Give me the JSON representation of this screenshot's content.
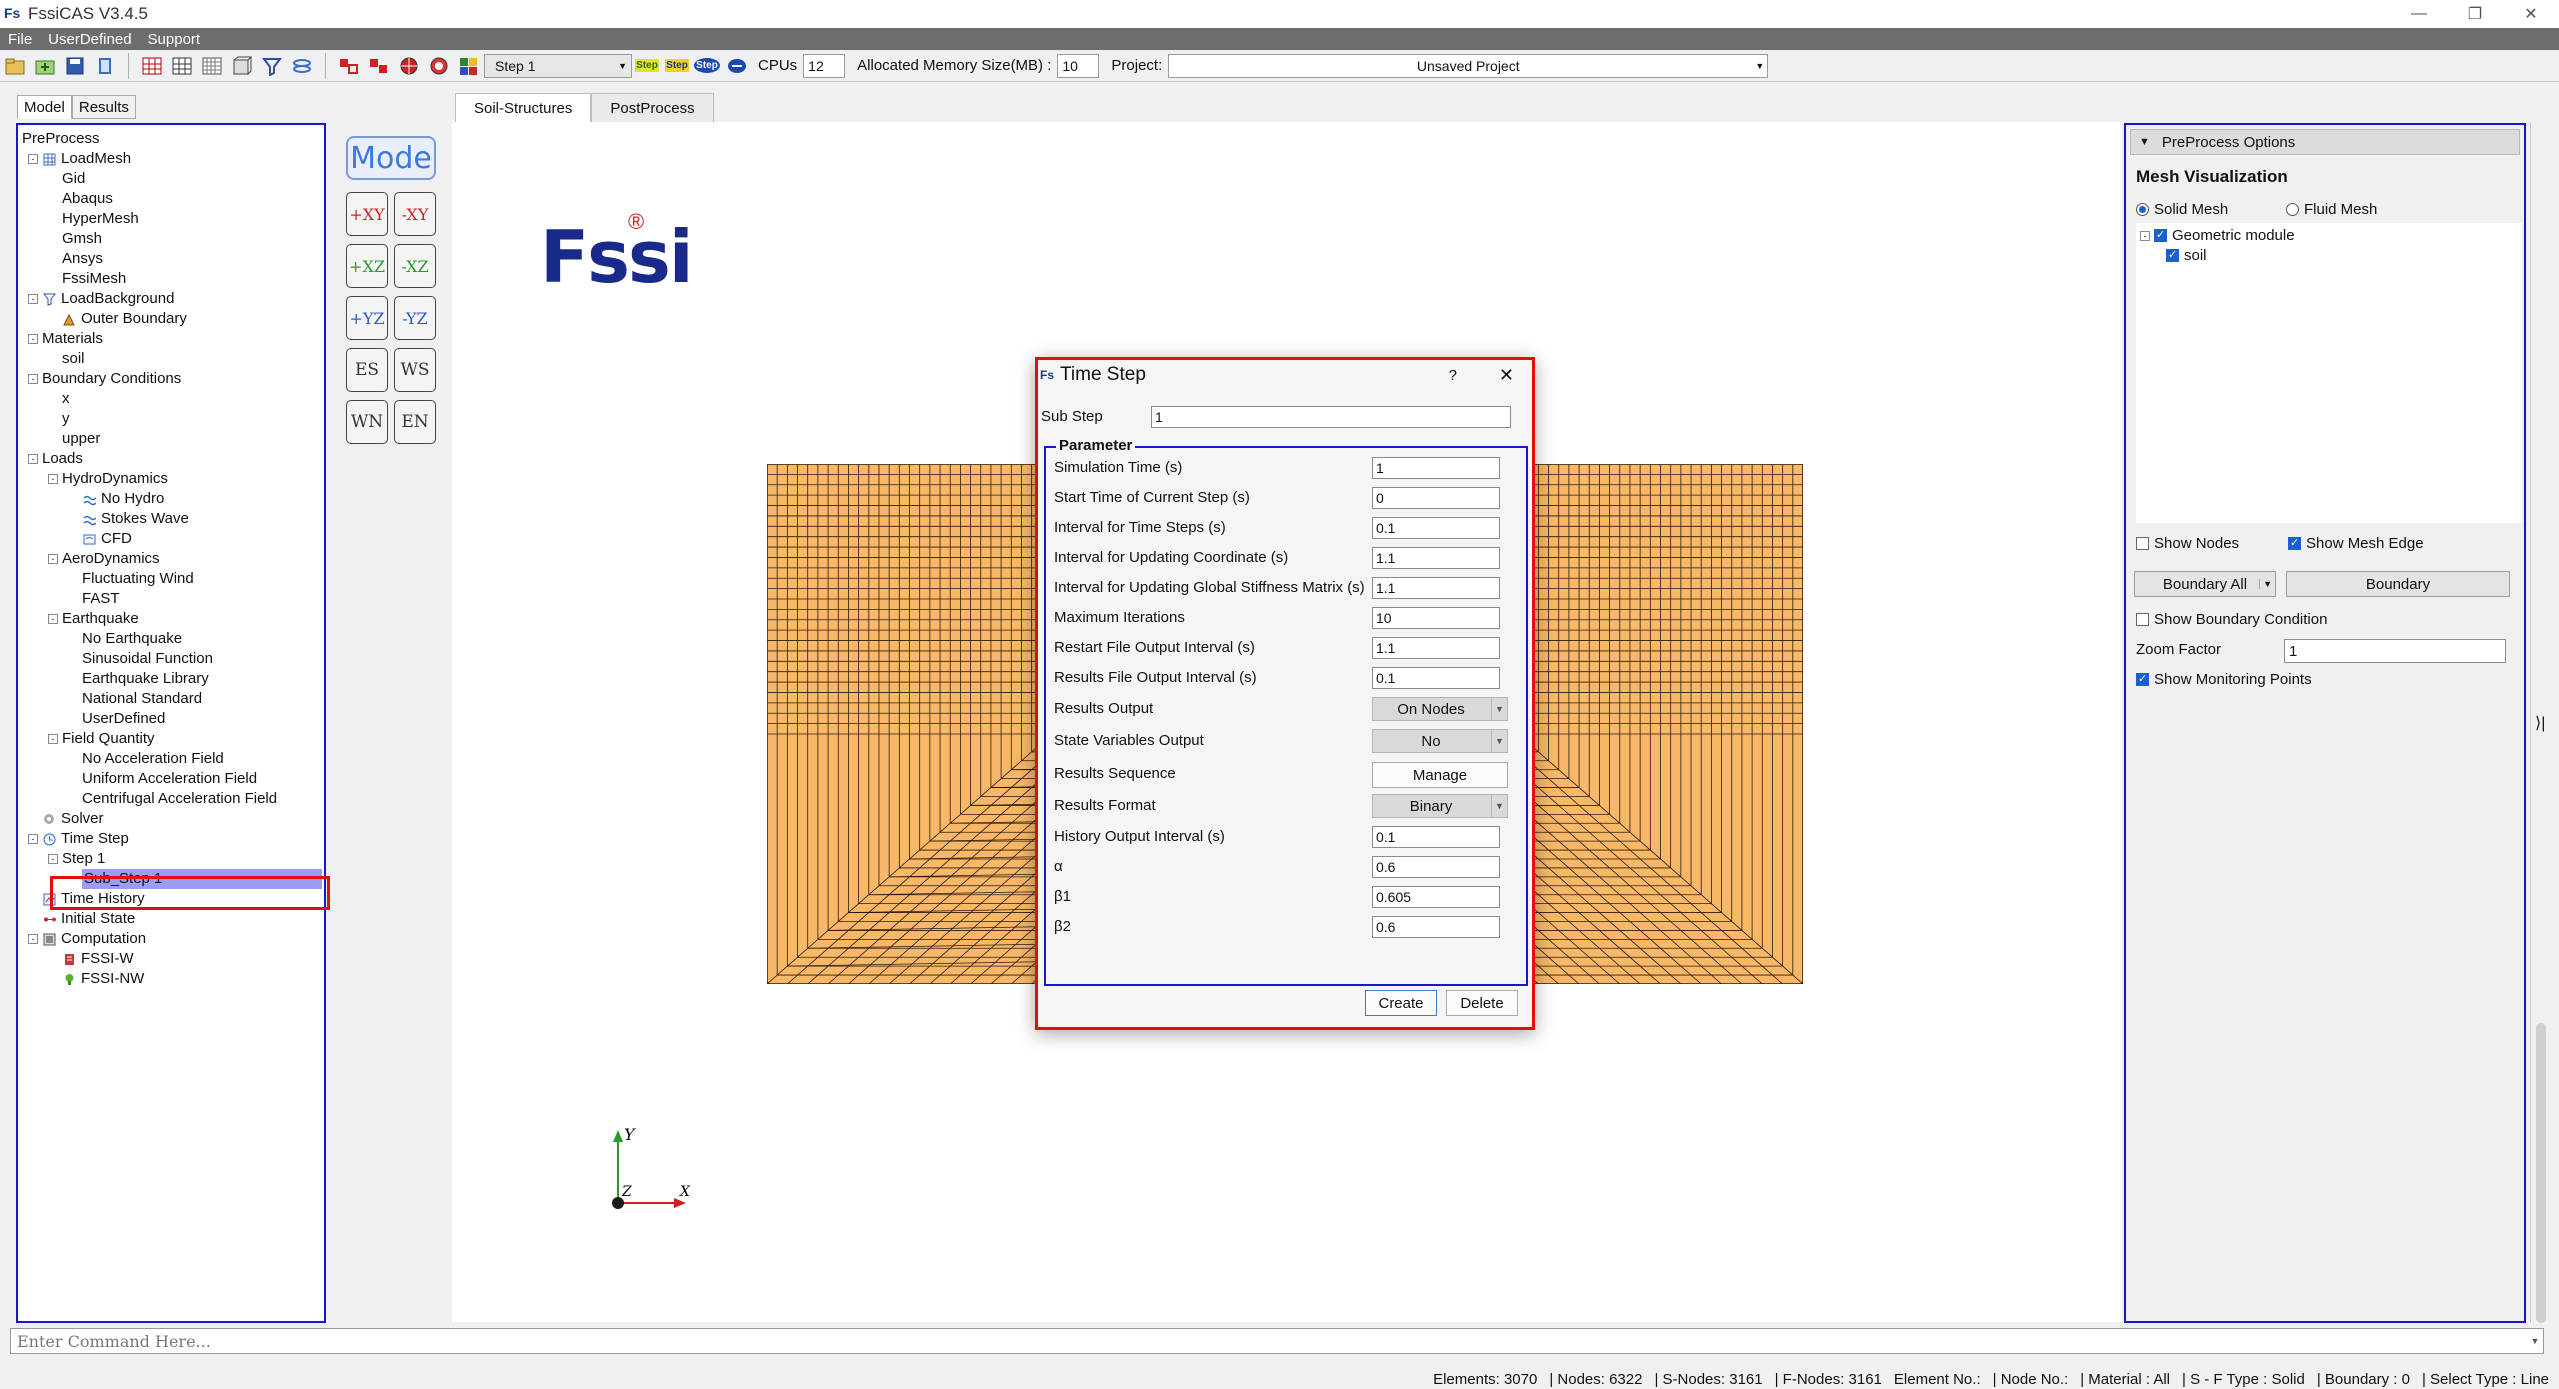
{
  "window": {
    "title": "FssiCAS V3.4.5",
    "logo_text": "Fs"
  },
  "menu": [
    "File",
    "UserDefined",
    "Support"
  ],
  "toolbar": {
    "step_select": "Step 1",
    "cpus_label": "CPUs",
    "cpus_value": "12",
    "memory_label": "Allocated Memory Size(MB) :",
    "memory_value": "10",
    "project_label": "Project:",
    "project_value": "Unsaved Project",
    "step_icons": [
      "Step",
      "Step",
      "Step"
    ]
  },
  "left_tabs": [
    "Model",
    "Results"
  ],
  "tree": [
    {
      "label": "PreProcess",
      "level": 0,
      "exp": "",
      "icon": ""
    },
    {
      "label": "LoadMesh",
      "level": 1,
      "exp": "-",
      "icon": "grid"
    },
    {
      "label": "Gid",
      "level": 2,
      "exp": "",
      "icon": ""
    },
    {
      "label": "Abaqus",
      "level": 2,
      "exp": "",
      "icon": ""
    },
    {
      "label": "HyperMesh",
      "level": 2,
      "exp": "",
      "icon": ""
    },
    {
      "label": "Gmsh",
      "level": 2,
      "exp": "",
      "icon": ""
    },
    {
      "label": "Ansys",
      "level": 2,
      "exp": "",
      "icon": ""
    },
    {
      "label": "FssiMesh",
      "level": 2,
      "exp": "",
      "icon": ""
    },
    {
      "label": "LoadBackground",
      "level": 1,
      "exp": "-",
      "icon": "funnel"
    },
    {
      "label": "Outer Boundary",
      "level": 2,
      "exp": "",
      "icon": "boundary"
    },
    {
      "label": "Materials",
      "level": 1,
      "exp": "-",
      "icon": ""
    },
    {
      "label": "soil",
      "level": 2,
      "exp": "",
      "icon": ""
    },
    {
      "label": "Boundary Conditions",
      "level": 1,
      "exp": "-",
      "icon": ""
    },
    {
      "label": "x",
      "level": 2,
      "exp": "",
      "icon": ""
    },
    {
      "label": "y",
      "level": 2,
      "exp": "",
      "icon": ""
    },
    {
      "label": "upper",
      "level": 2,
      "exp": "",
      "icon": ""
    },
    {
      "label": "Loads",
      "level": 1,
      "exp": "-",
      "icon": ""
    },
    {
      "label": "HydroDynamics",
      "level": 2,
      "exp": "-",
      "icon": ""
    },
    {
      "label": "No Hydro",
      "level": 3,
      "exp": "",
      "icon": "wave"
    },
    {
      "label": "Stokes Wave",
      "level": 3,
      "exp": "",
      "icon": "wave"
    },
    {
      "label": "CFD",
      "level": 3,
      "exp": "",
      "icon": "cfd"
    },
    {
      "label": "AeroDynamics",
      "level": 2,
      "exp": "-",
      "icon": ""
    },
    {
      "label": "Fluctuating Wind",
      "level": 3,
      "exp": "",
      "icon": ""
    },
    {
      "label": "FAST",
      "level": 3,
      "exp": "",
      "icon": ""
    },
    {
      "label": "Earthquake",
      "level": 2,
      "exp": "-",
      "icon": ""
    },
    {
      "label": "No Earthquake",
      "level": 3,
      "exp": "",
      "icon": ""
    },
    {
      "label": "Sinusoidal Function",
      "level": 3,
      "exp": "",
      "icon": ""
    },
    {
      "label": "Earthquake Library",
      "level": 3,
      "exp": "",
      "icon": ""
    },
    {
      "label": "National Standard",
      "level": 3,
      "exp": "",
      "icon": ""
    },
    {
      "label": "UserDefined",
      "level": 3,
      "exp": "",
      "icon": ""
    },
    {
      "label": "Field Quantity",
      "level": 2,
      "exp": "-",
      "icon": ""
    },
    {
      "label": "No Acceleration Field",
      "level": 3,
      "exp": "",
      "icon": ""
    },
    {
      "label": "Uniform Acceleration Field",
      "level": 3,
      "exp": "",
      "icon": ""
    },
    {
      "label": "Centrifugal Acceleration Field",
      "level": 3,
      "exp": "",
      "icon": ""
    },
    {
      "label": "Solver",
      "level": 1,
      "exp": "",
      "icon": "solver"
    },
    {
      "label": "Time Step",
      "level": 1,
      "exp": "-",
      "icon": "clock"
    },
    {
      "label": "Step 1",
      "level": 2,
      "exp": "-",
      "icon": ""
    },
    {
      "label": "Sub_Step 1",
      "level": 3,
      "exp": "",
      "icon": "",
      "selected": true
    },
    {
      "label": "Time History",
      "level": 1,
      "exp": "",
      "icon": "history"
    },
    {
      "label": "Initial State",
      "level": 1,
      "exp": "",
      "icon": "init"
    },
    {
      "label": "Computation",
      "level": 1,
      "exp": "-",
      "icon": "comp"
    },
    {
      "label": "FSSI-W",
      "level": 2,
      "exp": "",
      "icon": "fssiw"
    },
    {
      "label": "FSSI-NW",
      "level": 2,
      "exp": "",
      "icon": "fssinw"
    }
  ],
  "mode_panel": {
    "mode_label": "Mode",
    "buttons": [
      "+XY",
      "-XY",
      "+XZ",
      "-XZ",
      "+YZ",
      "-YZ",
      "ES",
      "WS",
      "WN",
      "EN"
    ]
  },
  "center_tabs": [
    "Soil-Structures",
    "PostProcess"
  ],
  "logo": {
    "text": "Fssi",
    "reg": "®"
  },
  "axes": {
    "y": "Y",
    "z": "Z",
    "x": "X"
  },
  "dialog": {
    "title": "Time Step",
    "help": "?",
    "close": "✕",
    "sub_step_label": "Sub Step",
    "sub_step_value": "1",
    "group_title": "Parameter",
    "fields": [
      {
        "label": "Simulation Time (s)",
        "type": "input",
        "value": "1"
      },
      {
        "label": "Start Time of Current Step (s)",
        "type": "input",
        "value": "0"
      },
      {
        "label": "Interval for Time Steps (s)",
        "type": "input",
        "value": "0.1"
      },
      {
        "label": "Interval for Updating Coordinate (s)",
        "type": "input",
        "value": "1.1"
      },
      {
        "label": "Interval for Updating Global Stiffness Matrix (s)",
        "type": "input",
        "value": "1.1"
      },
      {
        "label": "Maximum Iterations",
        "type": "input",
        "value": "10"
      },
      {
        "label": "Restart File Output Interval (s)",
        "type": "input",
        "value": "1.1"
      },
      {
        "label": "Results File Output Interval (s)",
        "type": "input",
        "value": "0.1"
      },
      {
        "label": "Results Output",
        "type": "combo",
        "value": "On Nodes"
      },
      {
        "label": "State Variables Output",
        "type": "combo",
        "value": "No"
      },
      {
        "label": "Results Sequence",
        "type": "button",
        "value": "Manage"
      },
      {
        "label": "Results Format",
        "type": "combo",
        "value": "Binary"
      },
      {
        "label": "History Output Interval (s)",
        "type": "input",
        "value": "0.1"
      },
      {
        "label": "α",
        "type": "input",
        "value": "0.6"
      },
      {
        "label": "β1",
        "type": "input",
        "value": "0.605"
      },
      {
        "label": "β2",
        "type": "input",
        "value": "0.6"
      }
    ],
    "create_label": "Create",
    "delete_label": "Delete"
  },
  "right_panel": {
    "header": "PreProcess Options",
    "section_title": "Mesh Visualization",
    "solid_mesh": "Solid Mesh",
    "fluid_mesh": "Fluid Mesh",
    "tree_root": "Geometric module",
    "tree_child": "soil",
    "show_nodes": "Show Nodes",
    "show_mesh_edge": "Show Mesh Edge",
    "boundary_all": "Boundary All",
    "boundary": "Boundary",
    "show_boundary_condition": "Show Boundary Condition",
    "zoom_factor_label": "Zoom Factor",
    "zoom_factor_value": "1",
    "show_monitoring_points": "Show Monitoring Points"
  },
  "command_placeholder": "Enter Command Here...",
  "status": [
    "Elements: 3070",
    "| Nodes: 6322",
    "| S-Nodes: 3161",
    "| F-Nodes: 3161",
    "Element No.:",
    "| Node No.:",
    "| Material :  All",
    "| S - F Type :  Solid",
    "| Boundary :  0",
    "| Select Type :  Line"
  ],
  "colors": {
    "mesh_fill": "#f8b868",
    "mesh_line": "#2a1a10",
    "highlight_border": "#e01010",
    "panel_border": "#1515d6",
    "selection": "#9c9cf0"
  }
}
